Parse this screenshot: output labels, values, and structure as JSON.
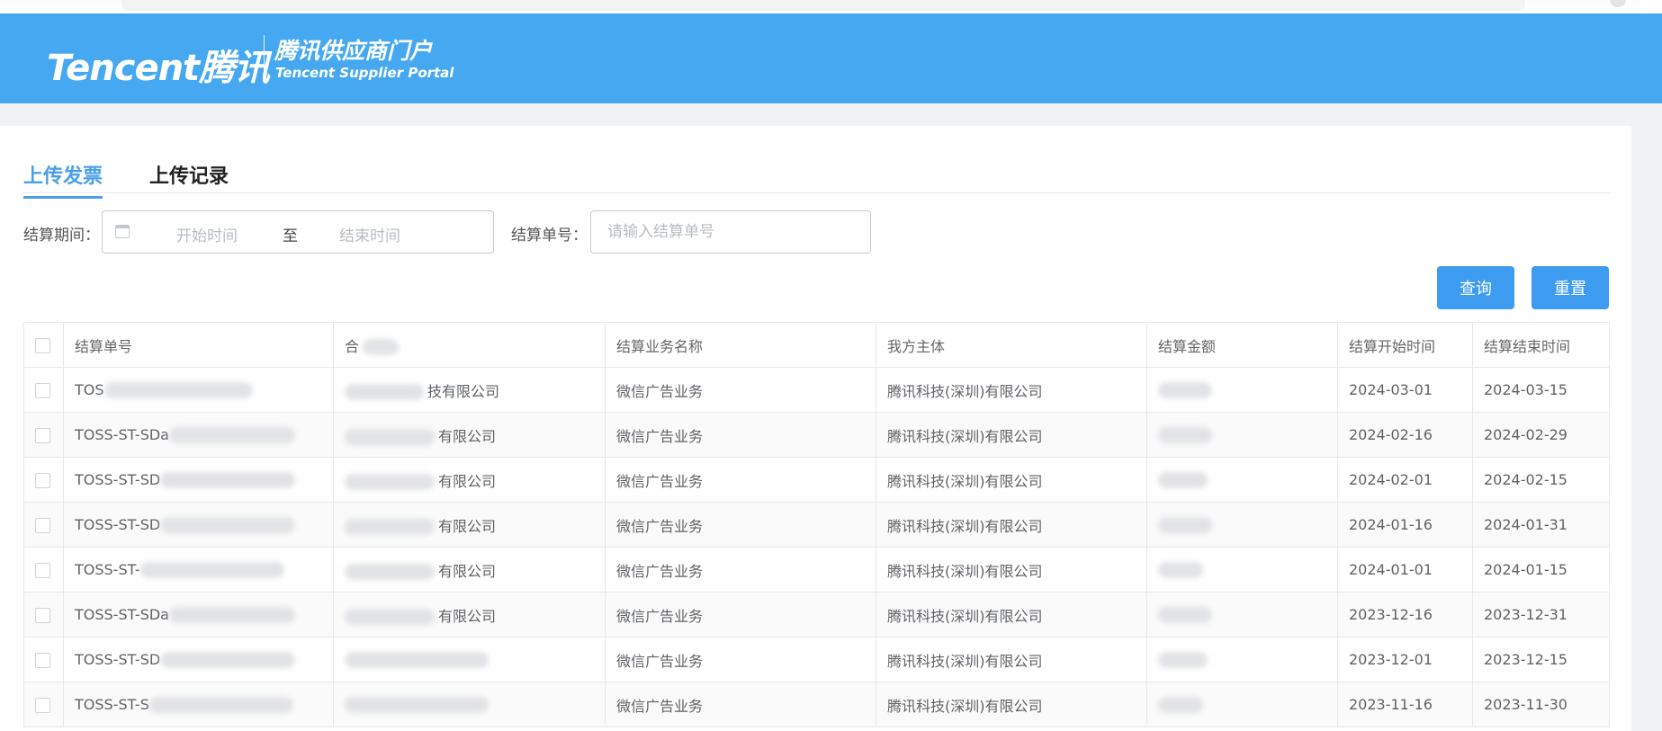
{
  "header": {
    "logo_main": "Tencent腾讯",
    "portal_cn": "腾讯供应商门户",
    "portal_en": "Tencent Supplier Portal",
    "bg_color": "#45a8f0"
  },
  "tabs": [
    {
      "label": "上传发票",
      "active": true
    },
    {
      "label": "上传记录",
      "active": false
    }
  ],
  "filters": {
    "period_label": "结算期间：",
    "start_placeholder": "开始时间",
    "range_sep": "至",
    "end_placeholder": "结束时间",
    "order_label": "结算单号：",
    "order_placeholder": "请输入结算单号"
  },
  "buttons": {
    "query": "查询",
    "reset": "重置",
    "color": "#3d9cf0"
  },
  "table": {
    "columns": [
      "结算单号",
      "合",
      "结算业务名称",
      "我方主体",
      "结算金额",
      "结算开始时间",
      "结算结束时间"
    ],
    "rows": [
      {
        "order": "TOS",
        "contract": "技有限公司",
        "biz": "微信广告业务",
        "entity": "腾讯科技(深圳)有限公司",
        "start": "2024-03-01",
        "end": "2024-03-15"
      },
      {
        "order": "TOSS-ST-SDa",
        "contract": "有限公司",
        "biz": "微信广告业务",
        "entity": "腾讯科技(深圳)有限公司",
        "start": "2024-02-16",
        "end": "2024-02-29"
      },
      {
        "order": "TOSS-ST-SD",
        "contract": "有限公司",
        "biz": "微信广告业务",
        "entity": "腾讯科技(深圳)有限公司",
        "start": "2024-02-01",
        "end": "2024-02-15"
      },
      {
        "order": "TOSS-ST-SD",
        "contract": "有限公司",
        "biz": "微信广告业务",
        "entity": "腾讯科技(深圳)有限公司",
        "start": "2024-01-16",
        "end": "2024-01-31"
      },
      {
        "order": "TOSS-ST-",
        "contract": "有限公司",
        "biz": "微信广告业务",
        "entity": "腾讯科技(深圳)有限公司",
        "start": "2024-01-01",
        "end": "2024-01-15"
      },
      {
        "order": "TOSS-ST-SDa",
        "contract": "有限公司",
        "biz": "微信广告业务",
        "entity": "腾讯科技(深圳)有限公司",
        "start": "2023-12-16",
        "end": "2023-12-31"
      },
      {
        "order": "TOSS-ST-SD",
        "contract": "",
        "biz": "微信广告业务",
        "entity": "腾讯科技(深圳)有限公司",
        "start": "2023-12-01",
        "end": "2023-12-15"
      },
      {
        "order": "TOSS-ST-S",
        "contract": "",
        "biz": "微信广告业务",
        "entity": "腾讯科技(深圳)有限公司",
        "start": "2023-11-16",
        "end": "2023-11-30"
      }
    ]
  }
}
